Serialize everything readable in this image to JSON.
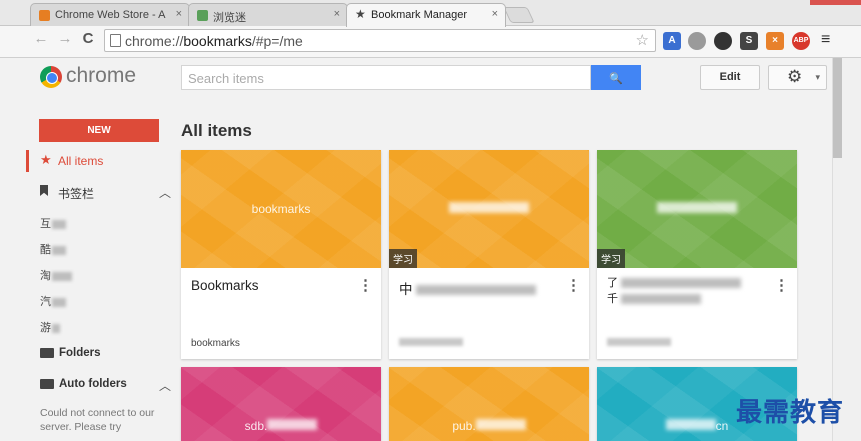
{
  "tabs": [
    {
      "title": "Chrome Web Store - A",
      "close": "×",
      "color": "#e67e22"
    },
    {
      "title": "浏览迷",
      "close": "×",
      "color": "#5aa05a"
    },
    {
      "title": "Bookmark Manager",
      "close": "×",
      "icon": "★"
    }
  ],
  "toolbar": {
    "back": "←",
    "forward": "→",
    "reload": "C",
    "url_scheme": "chrome://",
    "url_host": "bookmarks",
    "url_path": "/#p=/me",
    "menu": "≡",
    "extensions": [
      {
        "icon": "translate-icon",
        "label": "A",
        "color": "#3b6fd1"
      },
      {
        "icon": "globe-icon",
        "label": "",
        "color": "#9a9a9a"
      },
      {
        "icon": "steering-icon",
        "label": "",
        "color": "#333333"
      },
      {
        "icon": "s-icon",
        "label": "S",
        "color": "#444444"
      },
      {
        "icon": "x-icon",
        "label": "×",
        "color": "#e8812b"
      },
      {
        "icon": "abp-icon",
        "label": "ABP",
        "color": "#d8372c"
      }
    ]
  },
  "header": {
    "logo_text": "chrome",
    "search_placeholder": "Search items",
    "search_button": "🔍",
    "edit_label": "Edit",
    "gear": "⚙",
    "caret": "▾"
  },
  "sidebar": {
    "new_label": "NEW",
    "all_items": "All items",
    "bookmarks_bar": "书签栏",
    "sub_items": [
      "互",
      "酷",
      "淘",
      "汽",
      "游"
    ],
    "folders": "Folders",
    "auto_folders": "Auto folders",
    "message": "Could not connect to our server. Please try",
    "chev": "︿"
  },
  "main": {
    "heading": "All items",
    "cards": [
      {
        "thumb_text": "bookmarks",
        "color": "#f3a425",
        "tag": "",
        "title": "Bookmarks",
        "url": "bookmarks"
      },
      {
        "thumb_text": "",
        "color": "#f3a425",
        "tag": "学习",
        "title": "中",
        "url": ""
      },
      {
        "thumb_text": "",
        "color": "#71ad46",
        "tag": "学习",
        "title": "了",
        "title2": "千",
        "url": ""
      },
      {
        "thumb_text": "sdb.",
        "color": "#d63d78",
        "tag": "",
        "title": "",
        "url": ""
      },
      {
        "thumb_text": "pub.",
        "color": "#f3a425",
        "tag": "",
        "title": "",
        "url": ""
      },
      {
        "thumb_text": "cn",
        "color": "#22adc1",
        "tag": "",
        "title": "",
        "url": ""
      }
    ],
    "more": "⋮"
  },
  "watermark": "最需教育"
}
